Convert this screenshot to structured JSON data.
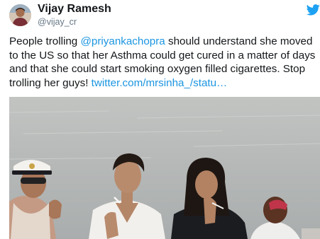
{
  "author": {
    "name": "Vijay Ramesh",
    "handle": "@vijay_cr"
  },
  "icons": {
    "brand": "twitter-bird-icon"
  },
  "colors": {
    "link": "#1b95e0",
    "brand": "#1da1f2",
    "handle": "#657786",
    "text": "#14171a"
  },
  "tweet": {
    "text_1": "People trolling ",
    "mention": "@priyankachopra",
    "text_2": " should understand she moved to the US so that her Asthma could get cured in a matter of days and that she could start smoking oxygen filled cigarettes. Stop trolling her guys! ",
    "link": "twitter.com/mrsinha_/statu…"
  }
}
